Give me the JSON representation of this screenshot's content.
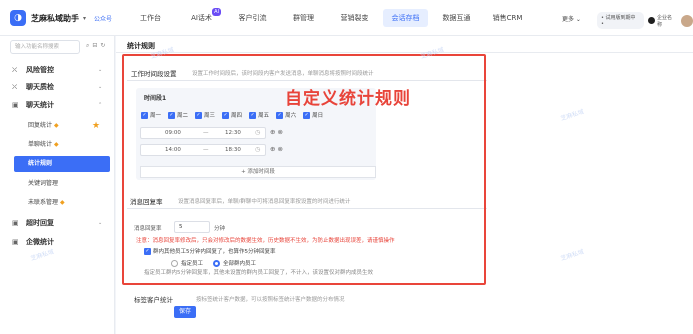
{
  "app": {
    "title": "芝麻私域助手",
    "caret": "▾",
    "version": "公众号"
  },
  "nav": {
    "items": [
      {
        "label": "工作台",
        "active": false
      },
      {
        "label": "AI话术",
        "badge": "AI",
        "active": false
      },
      {
        "label": "客户引流",
        "active": false
      },
      {
        "label": "群管理",
        "active": false
      },
      {
        "label": "营销裂变",
        "active": false
      },
      {
        "label": "会话存档",
        "active": true
      },
      {
        "label": "数据互通",
        "active": false
      },
      {
        "label": "销售CRM",
        "active": false
      }
    ],
    "more": "更多 ⌄",
    "trial": "• 试用版到期中 •",
    "user": "企业名称"
  },
  "sidebar": {
    "search_placeholder": "输入功能名称搜索",
    "groups": [
      {
        "label": "风险管控",
        "icon": "⛌",
        "chevron": "⌄"
      },
      {
        "label": "聊天质检",
        "icon": "⛌",
        "chevron": "⌄"
      },
      {
        "label": "聊天统计",
        "icon": "▣",
        "chevron": "⌃"
      }
    ],
    "subitems": [
      "回复统计",
      "单聊统计",
      "统计规则",
      "关键词管理",
      "未联系管理"
    ],
    "bottom_groups": [
      {
        "label": "超时回复",
        "icon": "▣",
        "chevron": "⌄"
      },
      {
        "label": "企微统计",
        "icon": "▣",
        "chevron": ""
      }
    ]
  },
  "page": {
    "title": "统计规则",
    "ribbon": "自定义统计规则",
    "work_time": {
      "title": "工作时间段设置",
      "desc": "设置工作时间段后，该时间段内客户发送消息，单聊消息将按照时间段统计"
    },
    "period": {
      "title": "时间段1",
      "days": [
        "周一",
        "周二",
        "周三",
        "周四",
        "周五",
        "周六",
        "周日"
      ],
      "rows": [
        {
          "start": "09:00",
          "to": "—",
          "end": "12:30"
        },
        {
          "start": "14:00",
          "to": "—",
          "end": "18:30"
        }
      ],
      "add": "+ 添加时间段"
    },
    "reply_rate": {
      "title": "消息回复率",
      "desc": "设置消息回复率后，单聊/群聊中可将消息回复率按设置的时间进行统计",
      "label": "消息回复率",
      "value": "5",
      "unit": "分钟",
      "warn": "注意：消息回复率修改后，只会对修改后的数据生效，历史数据不生效，为防止数据出现误差，请谨慎操作",
      "checkbox": "群内其他员工5分钟内回复了，也算作5分钟回复率",
      "radio_a": "指定员工",
      "radio_b": "全部群内员工",
      "note": "指定员工群内5分钟回复率，其他未设置的群内员工回复了，不计入，该设置仅对群内成员生效"
    },
    "next_section": "标签客户统计",
    "next_desc": "按标签统计客户数据，可以按照标签统计客户数据的分布情况",
    "save": "保存"
  },
  "colors": {
    "accent": "#3b6ef6",
    "highlight": "#e9453a"
  }
}
